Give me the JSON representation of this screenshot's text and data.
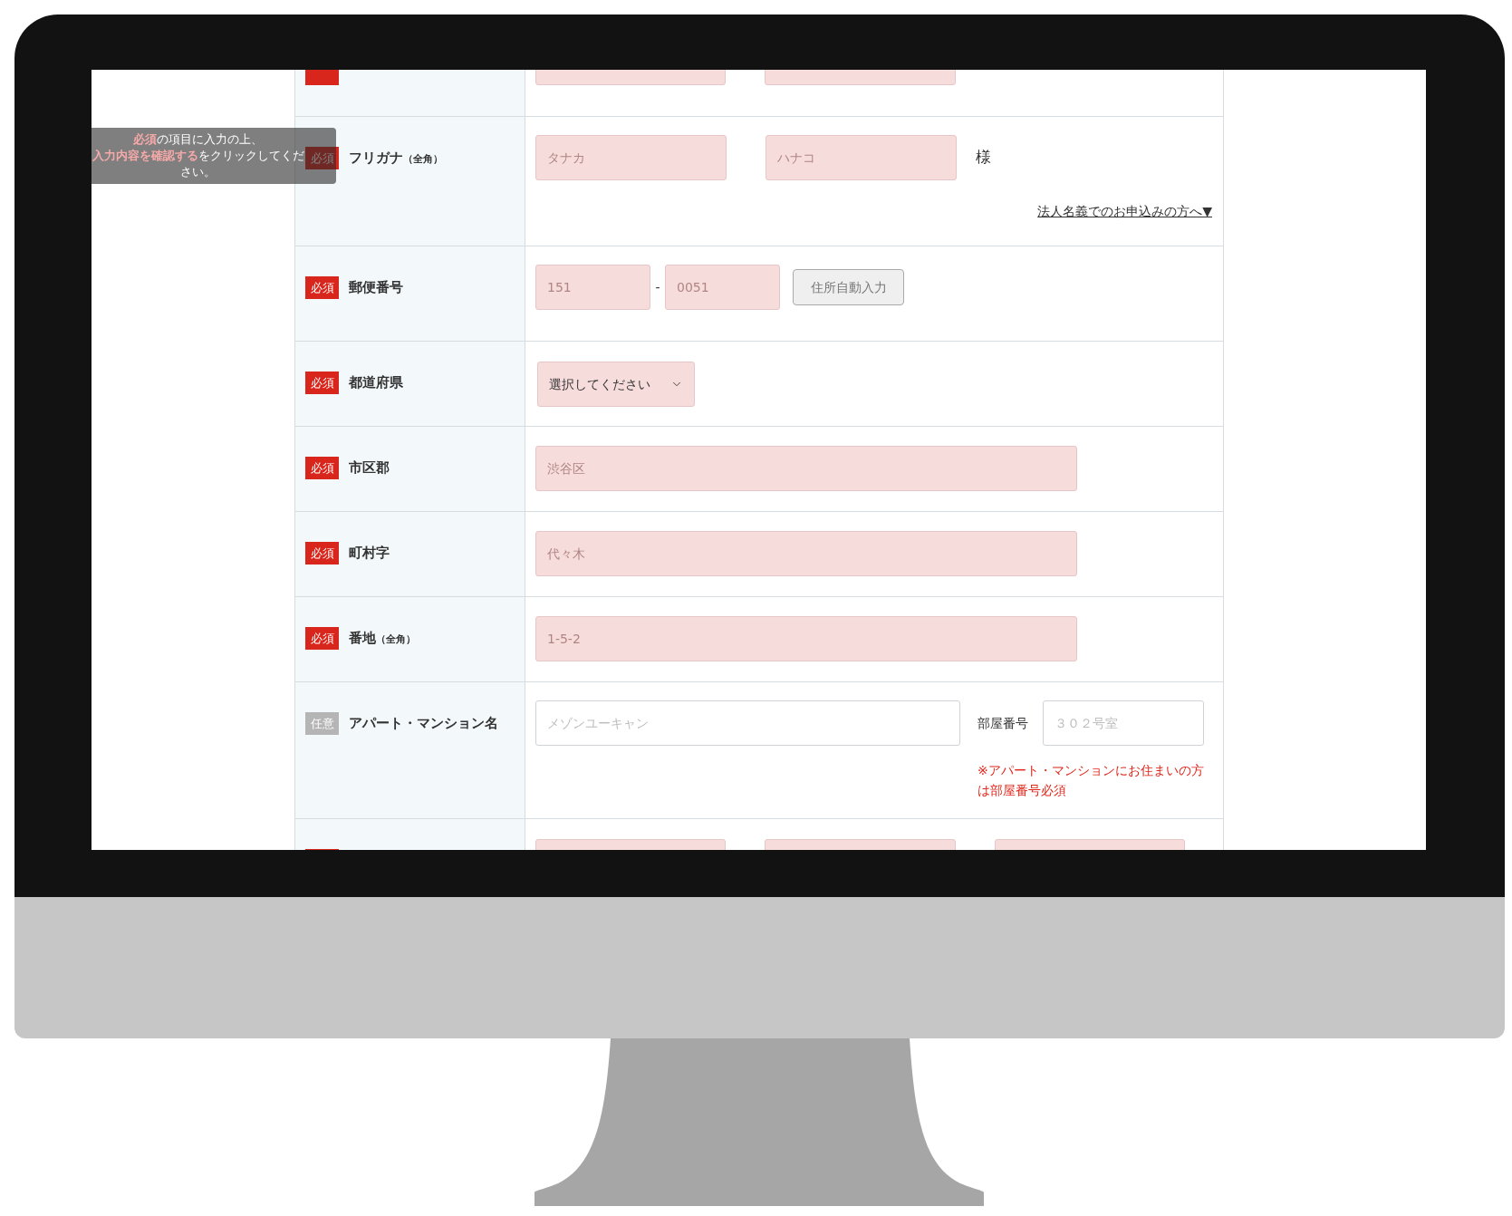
{
  "tooltip": {
    "lines": [
      "**必須**の項目に入力の上、",
      "**入力内容を確認する**をクリックしてください。"
    ]
  },
  "rows": [
    {
      "kind": "cut_top",
      "required": true
    },
    {
      "kind": "name",
      "required": true,
      "badge": "必須",
      "label": "フリガナ",
      "note": "（全角）",
      "placeholders": [
        "タナカ",
        "ハナコ"
      ],
      "suffix": "様",
      "link": "法人名義でのお申込みの方へ▼"
    },
    {
      "kind": "postal",
      "required": true,
      "badge": "必須",
      "label": "郵便番号",
      "placeholders": [
        "151",
        "0051"
      ],
      "separator": "-",
      "button": "住所自動入力"
    },
    {
      "kind": "select",
      "required": true,
      "badge": "必須",
      "label": "都道府県",
      "value": "選択してください"
    },
    {
      "kind": "text",
      "required": true,
      "badge": "必須",
      "label": "市区郡",
      "placeholder": "渋谷区"
    },
    {
      "kind": "text",
      "required": true,
      "badge": "必須",
      "label": "町村字",
      "placeholder": "代々木"
    },
    {
      "kind": "text",
      "required": true,
      "badge": "必須",
      "label": "番地",
      "note": "（全角）",
      "placeholder": "1-5-2"
    },
    {
      "kind": "apartment",
      "required": false,
      "badge": "任意",
      "label": "アパート・マンション名",
      "placeholder": "メゾンユーキャン",
      "room_label": "部屋番号",
      "room_placeholder": "３０２号室",
      "warning": "※アパート・マンションにお住まいの方は部屋番号必須"
    },
    {
      "kind": "cut_bottom",
      "required": true
    }
  ]
}
